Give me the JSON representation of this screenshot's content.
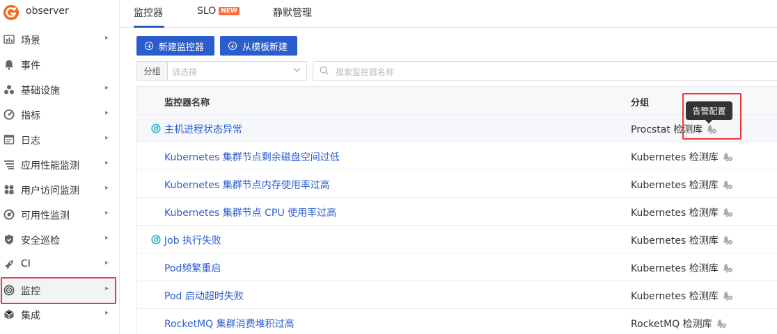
{
  "app": {
    "name": "observer",
    "brand_color": "#f26a1b",
    "accent": "#2b5dcc"
  },
  "sidebar": {
    "items": [
      {
        "label": "场景",
        "icon": "dashboard-icon",
        "has_children": true
      },
      {
        "label": "事件",
        "icon": "bell-icon",
        "has_children": false
      },
      {
        "label": "基础设施",
        "icon": "infrastructure-icon",
        "has_children": true
      },
      {
        "label": "指标",
        "icon": "metrics-icon",
        "has_children": true
      },
      {
        "label": "日志",
        "icon": "log-icon",
        "has_children": true
      },
      {
        "label": "应用性能监测",
        "icon": "apm-icon",
        "has_children": true
      },
      {
        "label": "用户访问监测",
        "icon": "rum-icon",
        "has_children": true
      },
      {
        "label": "可用性监测",
        "icon": "availability-icon",
        "has_children": true
      },
      {
        "label": "安全巡检",
        "icon": "shield-icon",
        "has_children": true
      },
      {
        "label": "CI",
        "icon": "rocket-icon",
        "has_children": true
      },
      {
        "label": "监控",
        "icon": "monitor-icon",
        "has_children": true,
        "active": true
      },
      {
        "label": "集成",
        "icon": "integration-icon",
        "has_children": true
      }
    ]
  },
  "tabs": [
    {
      "label": "监控器",
      "active": true
    },
    {
      "label": "SLO",
      "badge": "NEW"
    },
    {
      "label": "静默管理"
    }
  ],
  "toolbar": {
    "new_monitor": "新建监控器",
    "from_template": "从模板新建"
  },
  "filters": {
    "group_label": "分组",
    "group_placeholder": "请选择",
    "search_placeholder": "搜索监控器名称"
  },
  "table": {
    "columns": [
      "监控器名称",
      "分组"
    ],
    "rows": [
      {
        "name": "主机进程状态异常",
        "group": "Procstat 检测库",
        "status_icon": true
      },
      {
        "name": "Kubernetes 集群节点剩余磁盘空间过低",
        "group": "Kubernetes 检测库",
        "status_icon": false
      },
      {
        "name": "Kubernetes 集群节点内存使用率过高",
        "group": "Kubernetes 检测库",
        "status_icon": false
      },
      {
        "name": "Kubernetes 集群节点 CPU 使用率过高",
        "group": "Kubernetes 检测库",
        "status_icon": false
      },
      {
        "name": "Job 执行失败",
        "group": "Kubernetes 检测库",
        "status_icon": true
      },
      {
        "name": "Pod频繁重启",
        "group": "Kubernetes 检测库",
        "status_icon": false
      },
      {
        "name": "Pod 启动超时失败",
        "group": "Kubernetes 检测库",
        "status_icon": false
      },
      {
        "name": "RocketMQ 集群消费堆积过高",
        "group": "RocketMQ 检测库",
        "status_icon": false
      }
    ]
  },
  "tooltip": {
    "text": "告警配置"
  },
  "highlight_color": "#e83b3b"
}
